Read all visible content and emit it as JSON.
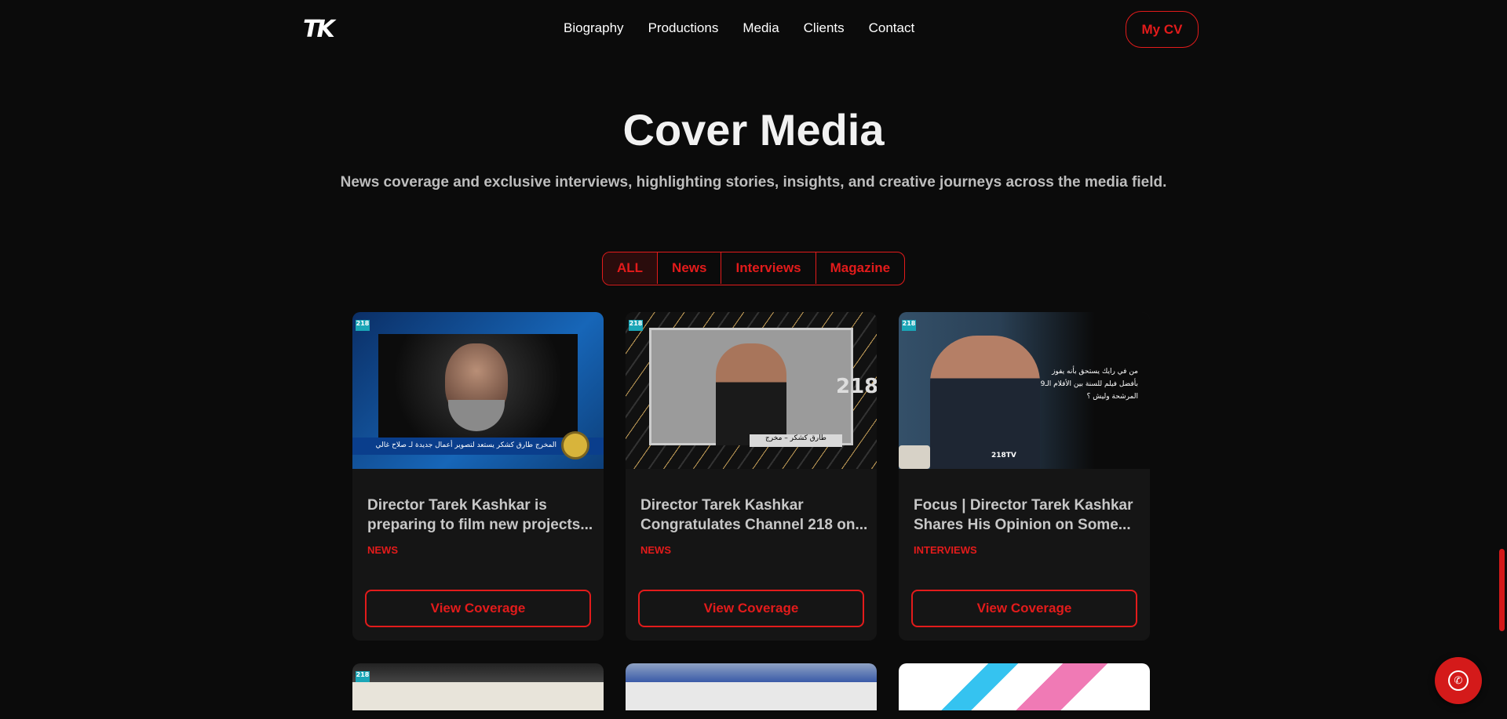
{
  "nav": {
    "logo": "TK",
    "items": [
      "Biography",
      "Productions",
      "Media",
      "Clients",
      "Contact"
    ],
    "cv_label": "My CV"
  },
  "hero": {
    "title": "Cover Media",
    "subtitle": "News coverage and exclusive interviews, highlighting stories, insights, and creative journeys across the media field."
  },
  "filters": [
    "ALL",
    "News",
    "Interviews",
    "Magazine"
  ],
  "cards": [
    {
      "title": "Director Tarek Kashkar is preparing to film new projects...",
      "category": "NEWS",
      "button": "View Coverage",
      "thumb_caption": "المخرج طارق كشكر يستعد لتصوير أعمال جديدة لـ صلاح غالي"
    },
    {
      "title": "Director Tarek Kashkar Congratulates Channel 218 on...",
      "category": "NEWS",
      "button": "View Coverage",
      "thumb_caption": "طارق كشكر – مخرج",
      "thumb_number": "218"
    },
    {
      "title": "Focus | Director Tarek Kashkar Shares His Opinion on Some...",
      "category": "INTERVIEWS",
      "button": "View Coverage",
      "thumb_caption": "من في رايك يستحق بأنه يفوز بأفضل فيلم للسنة بين الأفلام الـ9 المرشحة وليش ؟",
      "thumb_brand": "218TV"
    }
  ],
  "thumb_tag": "218",
  "colors": {
    "accent": "#e31b1b",
    "background": "#0b0b0b",
    "card": "#151515"
  },
  "icons": {
    "chat": "whatsapp-icon"
  }
}
